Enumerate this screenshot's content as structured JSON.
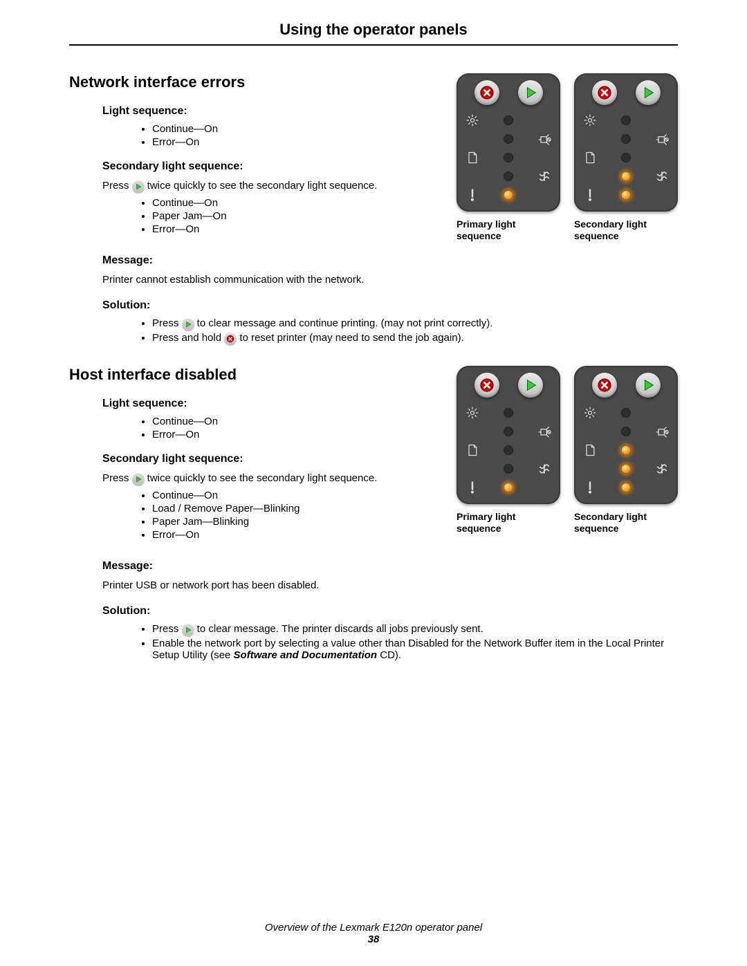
{
  "title": "Using the operator panels",
  "sections": [
    {
      "heading": "Network interface errors",
      "light_sequence_label": "Light sequence:",
      "light_sequence": [
        "Continue—On",
        "Error—On"
      ],
      "secondary_label": "Secondary light sequence:",
      "secondary_instruction_pre": "Press ",
      "secondary_instruction_post": " twice quickly to see the secondary light sequence.",
      "secondary_sequence": [
        "Continue—On",
        "Paper Jam—On",
        "Error—On"
      ],
      "message_label": "Message:",
      "message": "Printer cannot establish communication with the network.",
      "solution_label": "Solution:",
      "solution_items": [
        {
          "pre": "Press ",
          "icon": "go",
          "post": " to clear message and continue printing. (may not print correctly)."
        },
        {
          "pre": "Press and hold ",
          "icon": "cancel",
          "post": " to reset printer (may need to send the job again)."
        }
      ],
      "panels": {
        "primary_caption": "Primary light sequence",
        "secondary_caption": "Secondary light sequence",
        "primary_leds": {
          "ready": "dim",
          "toner": "dim",
          "paper": "dim",
          "jam": "dim",
          "error": "on"
        },
        "secondary_leds": {
          "ready": "dim",
          "toner": "dim",
          "paper": "dim",
          "jam": "on",
          "error": "on"
        }
      }
    },
    {
      "heading": "Host interface disabled",
      "light_sequence_label": "Light sequence:",
      "light_sequence": [
        "Continue—On",
        "Error—On"
      ],
      "secondary_label": "Secondary light sequence:",
      "secondary_instruction_pre": "Press ",
      "secondary_instruction_post": " twice quickly to see the secondary light sequence.",
      "secondary_sequence": [
        "Continue—On",
        "Load / Remove Paper—Blinking",
        "Paper Jam—Blinking",
        "Error—On"
      ],
      "message_label": "Message:",
      "message": "Printer USB or network port has been disabled.",
      "solution_label": "Solution:",
      "solution_items": [
        {
          "pre": "Press ",
          "icon": "go",
          "post": " to clear message. The printer discards all jobs previously sent."
        },
        {
          "text": "Enable the network port by selecting a value other than Disabled for the Network Buffer item in the Local Printer Setup Utility (see ",
          "bi": "Software and Documentation",
          "tail": " CD)."
        }
      ],
      "panels": {
        "primary_caption": "Primary light sequence",
        "secondary_caption": "Secondary light sequence",
        "primary_leds": {
          "ready": "dim",
          "toner": "dim",
          "paper": "dim",
          "jam": "dim",
          "error": "on"
        },
        "secondary_leds": {
          "ready": "dim",
          "toner": "dim",
          "paper": "on",
          "jam": "on",
          "error": "on"
        }
      }
    }
  ],
  "footer": {
    "caption": "Overview of the Lexmark E120n operator panel",
    "page": "38"
  }
}
